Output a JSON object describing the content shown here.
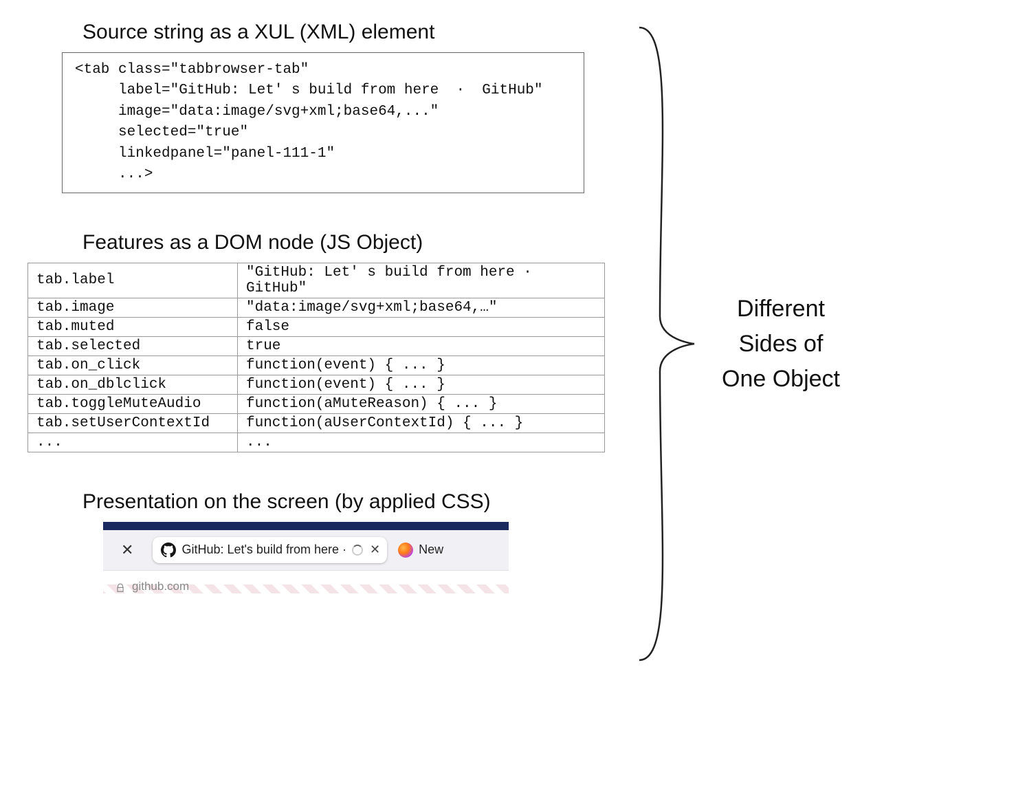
{
  "sections": {
    "xul_title": "Source string as a XUL (XML) element",
    "dom_title": "Features as a DOM node (JS Object)",
    "pres_title": "Presentation on the screen (by applied CSS)"
  },
  "xul_code": {
    "l1": "<tab class=\"tabbrowser-tab\"",
    "l2": "     label=\"GitHub: Let' s build from here  ·  GitHub\"",
    "l3": "     image=\"data:image/svg+xml;base64,...\"",
    "l4": "     selected=\"true\"",
    "l5": "     linkedpanel=\"panel-111-1\"",
    "l6": "     ...>"
  },
  "dom_rows": {
    "r0k": "tab.label",
    "r0v": "\"GitHub: Let' s build from here  ·  GitHub\"",
    "r1k": "tab.image",
    "r1v": "\"data:image/svg+xml;base64,…\"",
    "r2k": "tab.muted",
    "r2v": "false",
    "r3k": "tab.selected",
    "r3v": "true",
    "r4k": "tab.on_click",
    "r4v": "function(event) { ... }",
    "r5k": "tab.on_dblclick",
    "r5v": "function(event) { ... }",
    "r6k": "tab.toggleMuteAudio",
    "r6v": "function(aMuteReason) { ... }",
    "r7k": "tab.setUserContextId",
    "r7v": "function(aUserContextId) { ... }",
    "r8k": "...",
    "r8v": "..."
  },
  "presentation": {
    "active_tab_label": "GitHub: Let's build from here ·",
    "new_tab_label": "New",
    "url_text": "github.com"
  },
  "summary": {
    "line1": "Different",
    "line2": "Sides of",
    "line3": "One Object"
  }
}
